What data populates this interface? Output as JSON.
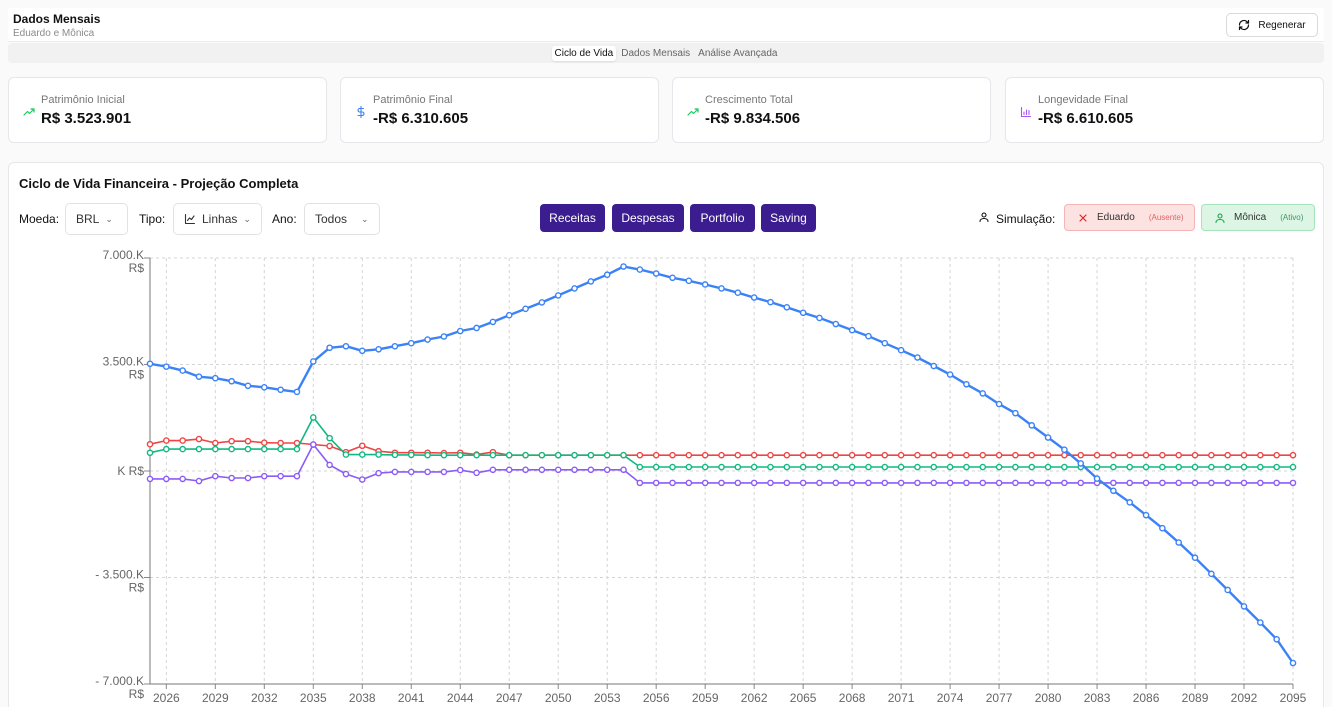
{
  "header": {
    "title": "Dados Mensais",
    "subtitle": "Eduardo e Mônica",
    "regen_label": "Regenerar"
  },
  "tabs": [
    {
      "label": "Ciclo de Vida",
      "active": true
    },
    {
      "label": "Dados Mensais",
      "active": false
    },
    {
      "label": "Análise Avançada",
      "active": false
    }
  ],
  "cards": [
    {
      "label": "Patrimônio Inicial",
      "value": "R$ 3.523.901",
      "icon": "trending-up-icon",
      "color": "#22c55e"
    },
    {
      "label": "Patrimônio Final",
      "value": "-R$ 6.310.605",
      "icon": "dollar-icon",
      "color": "#3b82f6"
    },
    {
      "label": "Crescimento Total",
      "value": "-R$ 9.834.506",
      "icon": "trending-up-icon",
      "color": "#22c55e"
    },
    {
      "label": "Longevidade Final",
      "value": "-R$ 6.610.605",
      "icon": "bar-chart-icon",
      "color": "#a855f7"
    }
  ],
  "panel": {
    "title": "Ciclo de Vida Financeira - Projeção Completa",
    "moeda_label": "Moeda:",
    "moeda_value": "BRL",
    "tipo_label": "Tipo:",
    "tipo_value": "Linhas",
    "ano_label": "Ano:",
    "ano_value": "Todos",
    "series_buttons": [
      "Receitas",
      "Despesas",
      "Portfolio",
      "Saving"
    ],
    "simulacao_label": "Simulação:",
    "people": [
      {
        "name": "Eduardo",
        "status": "(Ausente)"
      },
      {
        "name": "Mônica",
        "status": "(Ativo)"
      }
    ]
  },
  "chart_data": {
    "type": "line",
    "ylim": [
      -7000,
      7000
    ],
    "yticks": [
      {
        "value": 7000,
        "line1": "7.000.K",
        "line2": "R$"
      },
      {
        "value": 3500,
        "line1": "3.500.K",
        "line2": "R$"
      },
      {
        "value": 0,
        "line1": "K R$",
        "line2": ""
      },
      {
        "value": -3500,
        "line1": "- 3.500.K",
        "line2": "R$"
      },
      {
        "value": -7000,
        "line1": "- 7.000.K",
        "line2": "R$"
      }
    ],
    "xlim": [
      2025,
      2095
    ],
    "xticks": [
      2026,
      2029,
      2032,
      2035,
      2038,
      2041,
      2044,
      2047,
      2050,
      2053,
      2056,
      2059,
      2062,
      2065,
      2068,
      2071,
      2074,
      2077,
      2080,
      2083,
      2086,
      2089,
      2092,
      2095
    ],
    "grid": true,
    "series": [
      {
        "color": "#3b82f6",
        "points": [
          [
            2025,
            3524
          ],
          [
            2026,
            3430
          ],
          [
            2027,
            3300
          ],
          [
            2028,
            3100
          ],
          [
            2029,
            3050
          ],
          [
            2030,
            2950
          ],
          [
            2031,
            2800
          ],
          [
            2032,
            2750
          ],
          [
            2033,
            2670
          ],
          [
            2034,
            2600
          ],
          [
            2035,
            3600
          ],
          [
            2036,
            4050
          ],
          [
            2037,
            4100
          ],
          [
            2038,
            3950
          ],
          [
            2039,
            4000
          ],
          [
            2040,
            4100
          ],
          [
            2041,
            4200
          ],
          [
            2042,
            4320
          ],
          [
            2043,
            4420
          ],
          [
            2044,
            4600
          ],
          [
            2045,
            4700
          ],
          [
            2046,
            4900
          ],
          [
            2047,
            5120
          ],
          [
            2048,
            5330
          ],
          [
            2049,
            5540
          ],
          [
            2050,
            5770
          ],
          [
            2051,
            6000
          ],
          [
            2052,
            6230
          ],
          [
            2053,
            6450
          ],
          [
            2054,
            6720
          ],
          [
            2055,
            6620
          ],
          [
            2056,
            6490
          ],
          [
            2057,
            6350
          ],
          [
            2058,
            6250
          ],
          [
            2059,
            6130
          ],
          [
            2060,
            6000
          ],
          [
            2061,
            5860
          ],
          [
            2062,
            5700
          ],
          [
            2063,
            5550
          ],
          [
            2064,
            5380
          ],
          [
            2065,
            5200
          ],
          [
            2066,
            5030
          ],
          [
            2067,
            4830
          ],
          [
            2068,
            4630
          ],
          [
            2069,
            4430
          ],
          [
            2070,
            4200
          ],
          [
            2071,
            3970
          ],
          [
            2072,
            3730
          ],
          [
            2073,
            3450
          ],
          [
            2074,
            3170
          ],
          [
            2075,
            2850
          ],
          [
            2076,
            2550
          ],
          [
            2077,
            2200
          ],
          [
            2078,
            1900
          ],
          [
            2079,
            1500
          ],
          [
            2080,
            1100
          ],
          [
            2081,
            700
          ],
          [
            2082,
            250
          ],
          [
            2083,
            -250
          ],
          [
            2084,
            -650
          ],
          [
            2085,
            -1030
          ],
          [
            2086,
            -1450
          ],
          [
            2087,
            -1880
          ],
          [
            2088,
            -2350
          ],
          [
            2089,
            -2850
          ],
          [
            2090,
            -3380
          ],
          [
            2091,
            -3910
          ],
          [
            2092,
            -4450
          ],
          [
            2093,
            -4980
          ],
          [
            2094,
            -5530
          ],
          [
            2095,
            -6311
          ]
        ]
      },
      {
        "color": "#ef4444",
        "points": [
          [
            2025,
            880
          ],
          [
            2026,
            1000
          ],
          [
            2027,
            1000
          ],
          [
            2028,
            1050
          ],
          [
            2029,
            920
          ],
          [
            2030,
            980
          ],
          [
            2031,
            980
          ],
          [
            2032,
            930
          ],
          [
            2033,
            920
          ],
          [
            2034,
            920
          ],
          [
            2035,
            870
          ],
          [
            2036,
            820
          ],
          [
            2037,
            620
          ],
          [
            2038,
            830
          ],
          [
            2039,
            650
          ],
          [
            2040,
            600
          ],
          [
            2041,
            600
          ],
          [
            2042,
            600
          ],
          [
            2043,
            590
          ],
          [
            2044,
            600
          ],
          [
            2045,
            540
          ],
          [
            2046,
            620
          ],
          [
            2047,
            520
          ],
          [
            2048,
            520
          ],
          [
            2049,
            520
          ],
          [
            2050,
            520
          ],
          [
            2051,
            520
          ],
          [
            2052,
            520
          ],
          [
            2053,
            520
          ],
          [
            2054,
            520
          ],
          [
            2055,
            520
          ],
          [
            2056,
            520
          ],
          [
            2057,
            520
          ],
          [
            2058,
            520
          ],
          [
            2059,
            520
          ],
          [
            2060,
            520
          ],
          [
            2061,
            520
          ],
          [
            2062,
            520
          ],
          [
            2063,
            520
          ],
          [
            2064,
            520
          ],
          [
            2065,
            520
          ],
          [
            2066,
            520
          ],
          [
            2067,
            520
          ],
          [
            2068,
            520
          ],
          [
            2069,
            520
          ],
          [
            2070,
            520
          ],
          [
            2071,
            520
          ],
          [
            2072,
            520
          ],
          [
            2073,
            520
          ],
          [
            2074,
            520
          ],
          [
            2075,
            520
          ],
          [
            2076,
            520
          ],
          [
            2077,
            520
          ],
          [
            2078,
            520
          ],
          [
            2079,
            520
          ],
          [
            2080,
            520
          ],
          [
            2081,
            520
          ],
          [
            2082,
            520
          ],
          [
            2083,
            520
          ],
          [
            2084,
            520
          ],
          [
            2085,
            520
          ],
          [
            2086,
            520
          ],
          [
            2087,
            520
          ],
          [
            2088,
            520
          ],
          [
            2089,
            520
          ],
          [
            2090,
            520
          ],
          [
            2091,
            520
          ],
          [
            2092,
            520
          ],
          [
            2093,
            520
          ],
          [
            2094,
            520
          ],
          [
            2095,
            520
          ]
        ]
      },
      {
        "color": "#10b981",
        "points": [
          [
            2025,
            600
          ],
          [
            2026,
            720
          ],
          [
            2027,
            720
          ],
          [
            2028,
            720
          ],
          [
            2029,
            720
          ],
          [
            2030,
            720
          ],
          [
            2031,
            720
          ],
          [
            2032,
            720
          ],
          [
            2033,
            720
          ],
          [
            2034,
            720
          ],
          [
            2035,
            1760
          ],
          [
            2036,
            1080
          ],
          [
            2037,
            540
          ],
          [
            2038,
            540
          ],
          [
            2039,
            540
          ],
          [
            2040,
            530
          ],
          [
            2041,
            530
          ],
          [
            2042,
            520
          ],
          [
            2043,
            520
          ],
          [
            2044,
            520
          ],
          [
            2045,
            520
          ],
          [
            2046,
            520
          ],
          [
            2047,
            520
          ],
          [
            2048,
            520
          ],
          [
            2049,
            520
          ],
          [
            2050,
            520
          ],
          [
            2051,
            520
          ],
          [
            2052,
            520
          ],
          [
            2053,
            520
          ],
          [
            2054,
            520
          ],
          [
            2055,
            130
          ],
          [
            2056,
            130
          ],
          [
            2057,
            130
          ],
          [
            2058,
            130
          ],
          [
            2059,
            130
          ],
          [
            2060,
            130
          ],
          [
            2061,
            130
          ],
          [
            2062,
            130
          ],
          [
            2063,
            130
          ],
          [
            2064,
            130
          ],
          [
            2065,
            130
          ],
          [
            2066,
            130
          ],
          [
            2067,
            130
          ],
          [
            2068,
            130
          ],
          [
            2069,
            130
          ],
          [
            2070,
            130
          ],
          [
            2071,
            130
          ],
          [
            2072,
            130
          ],
          [
            2073,
            130
          ],
          [
            2074,
            130
          ],
          [
            2075,
            130
          ],
          [
            2076,
            130
          ],
          [
            2077,
            130
          ],
          [
            2078,
            130
          ],
          [
            2079,
            130
          ],
          [
            2080,
            130
          ],
          [
            2081,
            130
          ],
          [
            2082,
            130
          ],
          [
            2083,
            130
          ],
          [
            2084,
            130
          ],
          [
            2085,
            130
          ],
          [
            2086,
            130
          ],
          [
            2087,
            130
          ],
          [
            2088,
            130
          ],
          [
            2089,
            130
          ],
          [
            2090,
            130
          ],
          [
            2091,
            130
          ],
          [
            2092,
            130
          ],
          [
            2093,
            130
          ],
          [
            2094,
            130
          ],
          [
            2095,
            130
          ]
        ]
      },
      {
        "color": "#8b5cf6",
        "points": [
          [
            2025,
            -260
          ],
          [
            2026,
            -260
          ],
          [
            2027,
            -260
          ],
          [
            2028,
            -330
          ],
          [
            2029,
            -170
          ],
          [
            2030,
            -230
          ],
          [
            2031,
            -230
          ],
          [
            2032,
            -170
          ],
          [
            2033,
            -170
          ],
          [
            2034,
            -170
          ],
          [
            2035,
            870
          ],
          [
            2036,
            200
          ],
          [
            2037,
            -100
          ],
          [
            2038,
            -280
          ],
          [
            2039,
            -70
          ],
          [
            2040,
            -30
          ],
          [
            2041,
            -30
          ],
          [
            2042,
            -30
          ],
          [
            2043,
            -30
          ],
          [
            2044,
            30
          ],
          [
            2045,
            -60
          ],
          [
            2046,
            40
          ],
          [
            2047,
            40
          ],
          [
            2048,
            40
          ],
          [
            2049,
            40
          ],
          [
            2050,
            40
          ],
          [
            2051,
            40
          ],
          [
            2052,
            40
          ],
          [
            2053,
            40
          ],
          [
            2054,
            40
          ],
          [
            2055,
            -390
          ],
          [
            2056,
            -390
          ],
          [
            2057,
            -390
          ],
          [
            2058,
            -390
          ],
          [
            2059,
            -390
          ],
          [
            2060,
            -390
          ],
          [
            2061,
            -390
          ],
          [
            2062,
            -390
          ],
          [
            2063,
            -390
          ],
          [
            2064,
            -390
          ],
          [
            2065,
            -390
          ],
          [
            2066,
            -390
          ],
          [
            2067,
            -390
          ],
          [
            2068,
            -390
          ],
          [
            2069,
            -390
          ],
          [
            2070,
            -390
          ],
          [
            2071,
            -390
          ],
          [
            2072,
            -390
          ],
          [
            2073,
            -390
          ],
          [
            2074,
            -390
          ],
          [
            2075,
            -390
          ],
          [
            2076,
            -390
          ],
          [
            2077,
            -390
          ],
          [
            2078,
            -390
          ],
          [
            2079,
            -390
          ],
          [
            2080,
            -390
          ],
          [
            2081,
            -390
          ],
          [
            2082,
            -390
          ],
          [
            2083,
            -390
          ],
          [
            2084,
            -390
          ],
          [
            2085,
            -390
          ],
          [
            2086,
            -390
          ],
          [
            2087,
            -390
          ],
          [
            2088,
            -390
          ],
          [
            2089,
            -390
          ],
          [
            2090,
            -390
          ],
          [
            2091,
            -390
          ],
          [
            2092,
            -390
          ],
          [
            2093,
            -390
          ],
          [
            2094,
            -390
          ],
          [
            2095,
            -390
          ]
        ]
      }
    ]
  }
}
